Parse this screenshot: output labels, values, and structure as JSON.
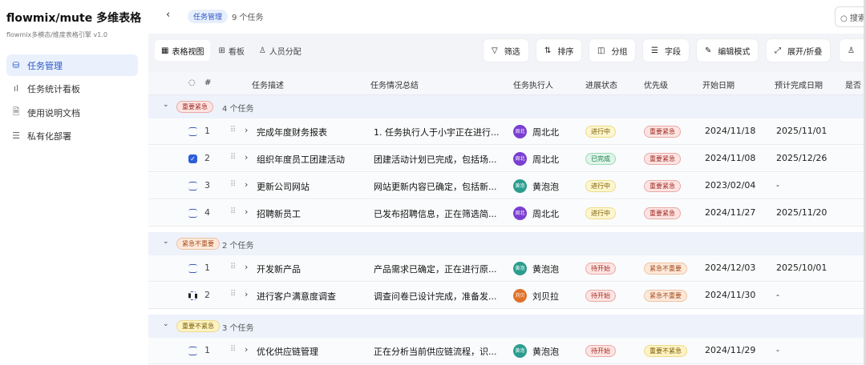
{
  "app": {
    "title": "flowmix/mute 多维表格",
    "subtitle": "flowmix多模态/维度表格引擎 v1.0"
  },
  "sidebar": {
    "items": [
      {
        "label": "任务管理",
        "icon": "database-icon",
        "active": true
      },
      {
        "label": "任务统计看板",
        "icon": "bar-chart-icon"
      },
      {
        "label": "使用说明文档",
        "icon": "document-icon"
      },
      {
        "label": "私有化部署",
        "icon": "server-icon"
      }
    ]
  },
  "topbar": {
    "breadcrumb": "任务管理",
    "count": "9 个任务",
    "search_placeholder": "搜索"
  },
  "views": [
    {
      "label": "表格视图",
      "icon": "table-icon"
    },
    {
      "label": "看板",
      "icon": "kanban-icon"
    },
    {
      "label": "人员分配",
      "icon": "user-icon"
    }
  ],
  "toolbar": {
    "filter": "筛选",
    "sort": "排序",
    "group": "分组",
    "fields": "字段",
    "edit_mode": "编辑模式",
    "expand": "展开/折叠"
  },
  "columns": [
    "#",
    "任务描述",
    "任务情况总结",
    "任务执行人",
    "进展状态",
    "优先级",
    "开始日期",
    "预计完成日期",
    "是否"
  ],
  "colors": {
    "accent": "#2e5fd8"
  },
  "groups": [
    {
      "tag": "重要紧急",
      "count": "4 个任务",
      "rows": [
        {
          "num": "1",
          "desc": "完成年度财务报表",
          "summary": "1. 任务执行人于小宇正在进行...",
          "avatar": "周北",
          "assignee": "周北北",
          "status": "进行中",
          "priority": "重要紧急",
          "start": "2024/11/18",
          "end": "2025/11/01"
        },
        {
          "num": "2",
          "desc": "组织年度员工团建活动",
          "summary": "团建活动计划已完成，包括场...",
          "avatar": "周北",
          "assignee": "周北北",
          "status": "已完成",
          "priority": "重要紧急",
          "start": "2024/11/08",
          "end": "2025/12/26",
          "checked": true
        },
        {
          "num": "3",
          "desc": "更新公司网站",
          "summary": "网站更新内容已确定，包括新...",
          "avatar": "黄泡",
          "assignee": "黄泡泡",
          "status": "进行中",
          "priority": "重要紧急",
          "start": "2023/02/04",
          "end": "-"
        },
        {
          "num": "4",
          "desc": "招聘新员工",
          "summary": "已发布招聘信息，正在筛选简...",
          "avatar": "周北",
          "assignee": "周北北",
          "status": "进行中",
          "priority": "重要紧急",
          "start": "2024/11/27",
          "end": "2025/11/20"
        }
      ]
    },
    {
      "tag": "紧急不重要",
      "count": "2 个任务",
      "rows": [
        {
          "num": "1",
          "desc": "开发新产品",
          "summary": "产品需求已确定，正在进行原...",
          "avatar": "黄泡",
          "assignee": "黄泡泡",
          "status": "待开始",
          "priority": "紧急不重要",
          "start": "2024/12/03",
          "end": "2025/10/01"
        },
        {
          "num": "2",
          "desc": "进行客户满意度调查",
          "summary": "调查问卷已设计完成，准备发...",
          "avatar": "刘贝",
          "assignee": "刘贝拉",
          "status": "待开始",
          "priority": "紧急不重要",
          "start": "2024/11/30",
          "end": "-"
        }
      ]
    },
    {
      "tag": "重要不紧急",
      "count": "3 个任务",
      "rows": [
        {
          "num": "1",
          "desc": "优化供应链管理",
          "summary": "正在分析当前供应链流程，识...",
          "avatar": "黄泡",
          "assignee": "黄泡泡",
          "status": "待开始",
          "priority": "重要不紧急",
          "start": "2024/11/29",
          "end": "-"
        }
      ]
    }
  ]
}
